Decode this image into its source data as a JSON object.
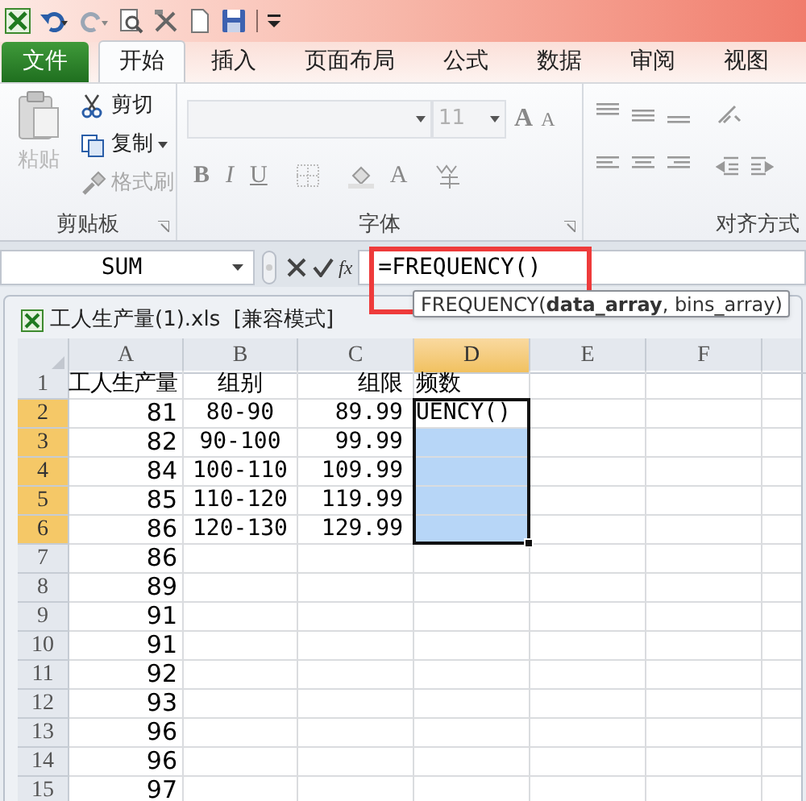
{
  "ribbon_tabs": [
    {
      "label": "文件",
      "kind": "file",
      "selected": false
    },
    {
      "label": "开始",
      "kind": "tab",
      "selected": true
    },
    {
      "label": "插入",
      "kind": "tab",
      "selected": false
    },
    {
      "label": "页面布局",
      "kind": "tab",
      "selected": false
    },
    {
      "label": "公式",
      "kind": "tab",
      "selected": false
    },
    {
      "label": "数据",
      "kind": "tab",
      "selected": false
    },
    {
      "label": "审阅",
      "kind": "tab",
      "selected": false
    },
    {
      "label": "视图",
      "kind": "tab",
      "selected": false
    }
  ],
  "clipboard": {
    "paste": {
      "label": "粘贴",
      "disabled": true
    },
    "items": [
      {
        "label": "剪切",
        "kind": "cut",
        "disabled": false
      },
      {
        "label": "复制",
        "kind": "copy",
        "disabled": false
      },
      {
        "label": "格式刷",
        "kind": "brush",
        "disabled": true
      }
    ],
    "group_label": "剪贴板"
  },
  "font": {
    "size": "11",
    "grow": "A",
    "shrink": "A",
    "bold": "B",
    "italic": "I",
    "underline": "U",
    "color_letter": "A",
    "group_label": "字体"
  },
  "alignment": {
    "group_label": "对齐方式"
  },
  "formula_bar": {
    "name_box": "SUM",
    "function_button": "fx",
    "formula": "=FREQUENCY()"
  },
  "tooltip": "FREQUENCY(**data_array**, bins_array)",
  "workbook": {
    "title": "工人生产量(1).xls  [兼容模式]",
    "columns": [
      {
        "label": "A",
        "selected": false
      },
      {
        "label": "B",
        "selected": false
      },
      {
        "label": "C",
        "selected": false
      },
      {
        "label": "D",
        "selected": true
      },
      {
        "label": "E",
        "selected": false
      },
      {
        "label": "F",
        "selected": false
      }
    ],
    "rows": [
      {
        "label": "1",
        "selected": false,
        "cells": [
          "工人生产量",
          "组别",
          "组限",
          "频数"
        ]
      },
      {
        "label": "2",
        "selected": true,
        "cells": [
          "81",
          "80-90",
          "89.99",
          "UENCY()"
        ]
      },
      {
        "label": "3",
        "selected": true,
        "cells": [
          "82",
          "90-100",
          "99.99"
        ]
      },
      {
        "label": "4",
        "selected": true,
        "cells": [
          "84",
          "100-110",
          "109.99"
        ]
      },
      {
        "label": "5",
        "selected": true,
        "cells": [
          "85",
          "110-120",
          "119.99"
        ]
      },
      {
        "label": "6",
        "selected": true,
        "cells": [
          "86",
          "120-130",
          "129.99"
        ]
      },
      {
        "label": "7",
        "selected": false,
        "cells": [
          "86"
        ]
      },
      {
        "label": "8",
        "selected": false,
        "cells": [
          "89"
        ]
      },
      {
        "label": "9",
        "selected": false,
        "cells": [
          "91"
        ]
      },
      {
        "label": "10",
        "selected": false,
        "cells": [
          "91"
        ]
      },
      {
        "label": "11",
        "selected": false,
        "cells": [
          "92"
        ]
      },
      {
        "label": "12",
        "selected": false,
        "cells": [
          "93"
        ]
      },
      {
        "label": "13",
        "selected": false,
        "cells": [
          "96"
        ]
      },
      {
        "label": "14",
        "selected": false,
        "cells": [
          "96"
        ]
      },
      {
        "label": "15",
        "selected": false,
        "cells": [
          "97"
        ]
      }
    ]
  }
}
